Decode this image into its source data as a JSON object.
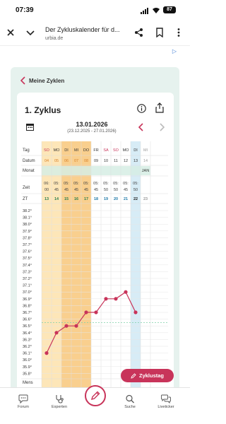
{
  "status": {
    "time": "07:39",
    "battery": "87"
  },
  "browser": {
    "title": "Der Zykluskalender für d...",
    "url": "urbia.de",
    "ad_marker": "▷"
  },
  "nav": {
    "back_label": "Meine Zyklen"
  },
  "cycle": {
    "title": "1. Zyklus",
    "date": "13.01.2026",
    "range": "(23.12.2025 - 27.01.2026)"
  },
  "table": {
    "row_labels": {
      "tag": "Tag",
      "datum": "Datum",
      "monat": "Monat",
      "zeit": "Zeit",
      "zt": "ZT",
      "mens": "Mens"
    },
    "month_marker": "JAN",
    "days": [
      {
        "tag": "SO",
        "datum": "04",
        "zeit_h": "06:",
        "zeit_m": "00",
        "zt": "13"
      },
      {
        "tag": "MO",
        "datum": "05",
        "zeit_h": "05:",
        "zeit_m": "45",
        "zt": "14"
      },
      {
        "tag": "DI",
        "datum": "06",
        "zeit_h": "05:",
        "zeit_m": "45",
        "zt": "15"
      },
      {
        "tag": "MI",
        "datum": "07",
        "zeit_h": "05:",
        "zeit_m": "45",
        "zt": "16"
      },
      {
        "tag": "DO",
        "datum": "08",
        "zeit_h": "05:",
        "zeit_m": "45",
        "zt": "17"
      },
      {
        "tag": "FR",
        "datum": "09",
        "zeit_h": "05:",
        "zeit_m": "45",
        "zt": "18"
      },
      {
        "tag": "SA",
        "datum": "10",
        "zeit_h": "05:",
        "zeit_m": "50",
        "zt": "19"
      },
      {
        "tag": "SO",
        "datum": "11",
        "zeit_h": "05:",
        "zeit_m": "50",
        "zt": "20"
      },
      {
        "tag": "MO",
        "datum": "12",
        "zeit_h": "05:",
        "zeit_m": "45",
        "zt": "21"
      },
      {
        "tag": "DI",
        "datum": "13",
        "zeit_h": "05:",
        "zeit_m": "50",
        "zt": "22"
      },
      {
        "tag": "MI",
        "datum": "14",
        "zeit_h": "",
        "zeit_m": "",
        "zt": "23"
      }
    ],
    "highlights": {
      "menses_shade": [
        0,
        1,
        2,
        3,
        4
      ],
      "today_index": 9
    }
  },
  "chart_data": {
    "type": "line",
    "title": "",
    "xlabel": "",
    "ylabel": "",
    "x": [
      "04",
      "05",
      "06",
      "07",
      "08",
      "09",
      "10",
      "11",
      "12",
      "13"
    ],
    "series": [
      {
        "values": [
          36.1,
          36.4,
          36.5,
          36.5,
          36.7,
          36.7,
          36.9,
          36.9,
          37.0,
          36.7
        ]
      }
    ],
    "y_ticks": [
      "38.2°",
      "38.1°",
      "38.0°",
      "37.9°",
      "37.8°",
      "37.7°",
      "37.6°",
      "37.5°",
      "37.4°",
      "37.3°",
      "37.2°",
      "37.1°",
      "37.0°",
      "36.9°",
      "36.8°",
      "36.7°",
      "36.6°",
      "36.5°",
      "36.4°",
      "36.3°",
      "36.2°",
      "36.1°",
      "36.0°",
      "35.9°",
      "35.8°"
    ],
    "ylim": [
      35.8,
      38.2
    ],
    "coverline": 36.55,
    "grid": true,
    "colors": {
      "line": "#c8345a",
      "coverline": "#7fd0a8"
    }
  },
  "fab": {
    "label": "Zyklustag"
  },
  "tabbar": {
    "items": [
      {
        "label": "Forum",
        "icon": "chat-bubble-icon"
      },
      {
        "label": "Experten",
        "icon": "stethoscope-icon"
      },
      {
        "label": "",
        "icon": "pencil-icon"
      },
      {
        "label": "Suche",
        "icon": "search-icon"
      },
      {
        "label": "Liveticker",
        "icon": "chat-bubbles-icon"
      }
    ]
  },
  "colors": {
    "accent": "#c8345a",
    "frame": "#e6f2ee",
    "menses_light": "#fde6b8",
    "menses_dark": "#f9cf8e",
    "today": "#d7ecf6",
    "month_band": "#d6ede4"
  }
}
